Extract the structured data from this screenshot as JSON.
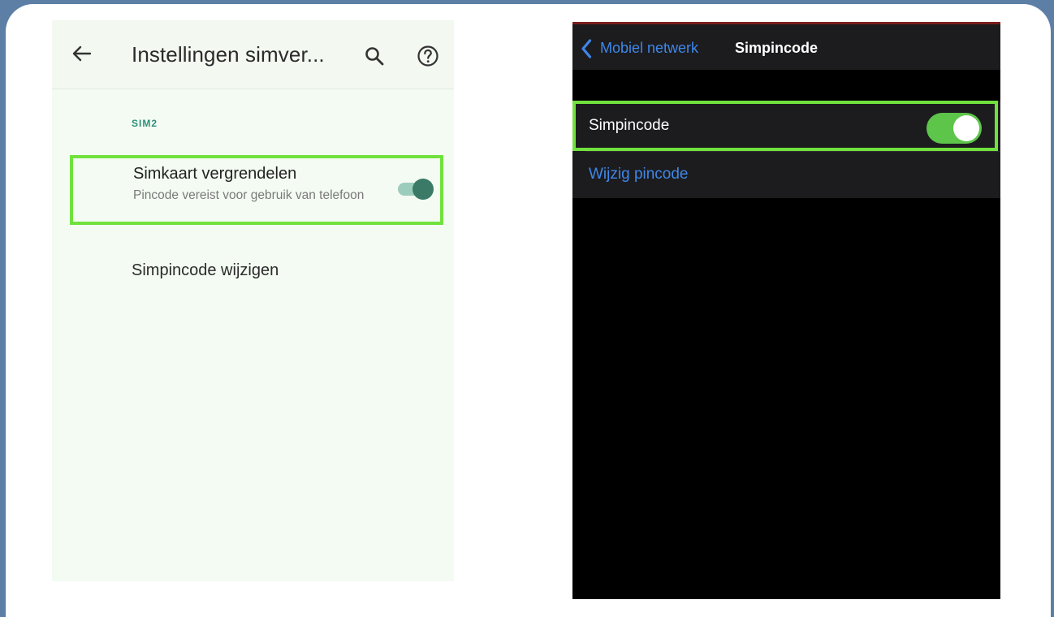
{
  "android": {
    "title": "Instellingen simver...",
    "section_header": "SIM2",
    "lock_item": {
      "title": "Simkaart vergrendelen",
      "subtitle": "Pincode vereist voor gebruik van telefoon",
      "toggle_on": true
    },
    "change_pin_label": "Simpincode wijzigen",
    "icons": [
      "back-arrow-icon",
      "search-icon",
      "help-icon"
    ],
    "colors": {
      "accent": "#3b7a66",
      "highlight": "#71e13d",
      "section": "#2f8f7a"
    }
  },
  "ios": {
    "back_label": "Mobiel netwerk",
    "title": "Simpincode",
    "pin_row_label": "Simpincode",
    "pin_switch_on": true,
    "change_pin_label": "Wijzig pincode",
    "icons": [
      "chevron-left-icon"
    ],
    "colors": {
      "link": "#3f86e8",
      "switch_on": "#5cc54a",
      "highlight": "#71e13d"
    }
  }
}
